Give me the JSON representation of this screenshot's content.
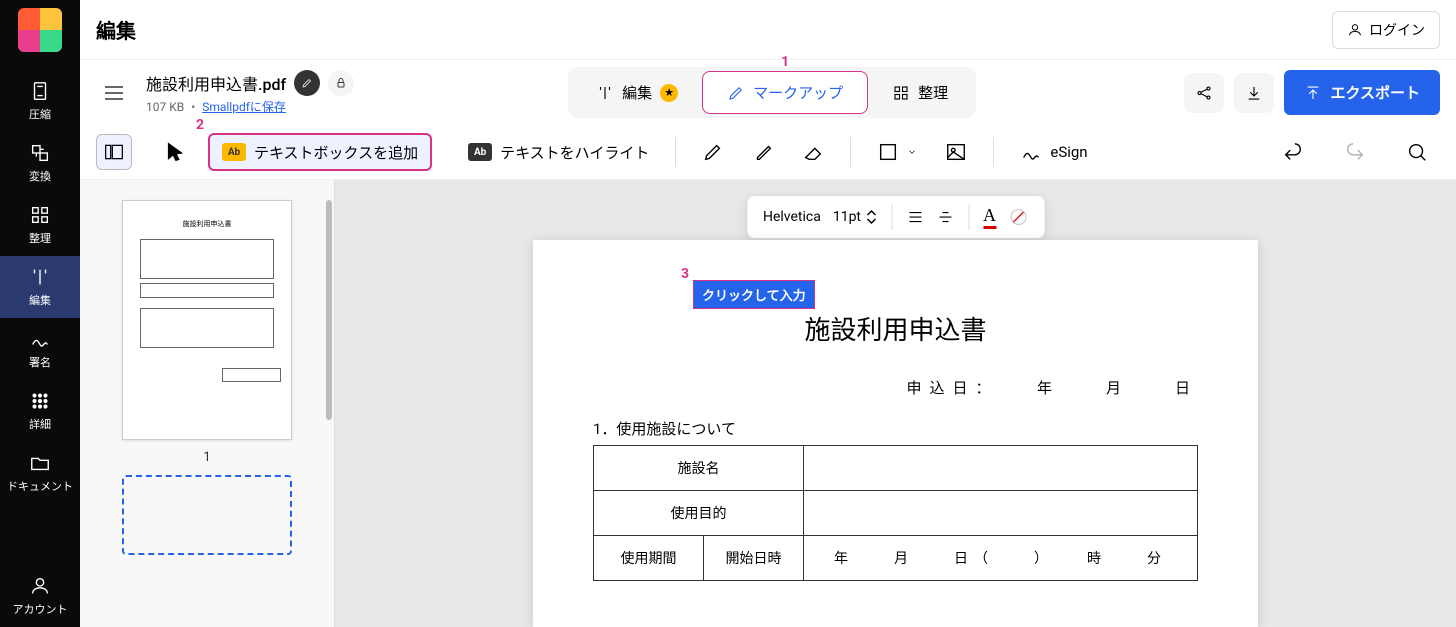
{
  "header": {
    "title": "編集",
    "login_label": "ログイン"
  },
  "file": {
    "name": "施設利用申込書.pdf",
    "size": "107 KB",
    "save_link": "Smallpdfに保存",
    "separator": " ・ "
  },
  "tabs": {
    "edit": "編集",
    "markup": "マークアップ",
    "organize": "整理"
  },
  "export_label": "エクスポート",
  "toolbar": {
    "add_textbox": "テキストボックスを追加",
    "highlight_text": "テキストをハイライト",
    "esign": "eSign"
  },
  "format_bar": {
    "font": "Helvetica",
    "size": "11pt"
  },
  "annotations": {
    "one": "1",
    "two": "2",
    "three": "3"
  },
  "document": {
    "click_placeholder": "クリックして入力",
    "title": "施設利用申込書",
    "date_label": "申込日：",
    "date_units": "年　　月　　日",
    "section1": "1．使用施設について",
    "rows": {
      "facility_name": "施設名",
      "purpose": "使用目的",
      "period": "使用期間",
      "start_datetime": "開始日時",
      "datetime_value": "年　　月　　日（　　）　　時　　分"
    }
  },
  "thumbnail": {
    "page_num": "1",
    "title_small": "施設利用申込書"
  },
  "sidebar": {
    "compress": "圧縮",
    "convert": "変換",
    "organize": "整理",
    "edit": "編集",
    "sign": "署名",
    "detail": "詳細",
    "document": "ドキュメント",
    "account": "アカウント"
  }
}
